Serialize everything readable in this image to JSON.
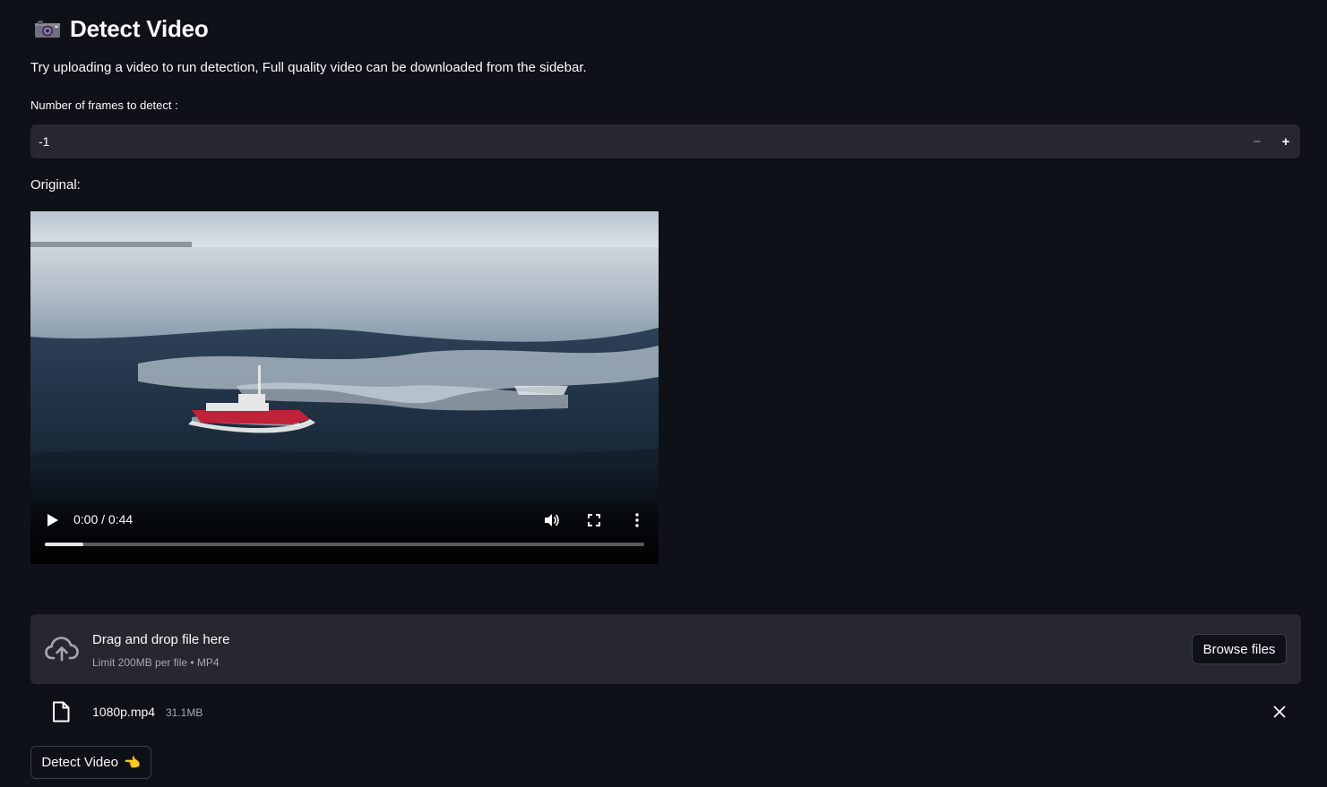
{
  "page": {
    "title": "Detect Video",
    "title_icon": "camera-icon",
    "intro": "Try uploading a video to run detection, Full quality video can be downloaded from the sidebar."
  },
  "frames_input": {
    "label": "Number of frames to detect :",
    "value": "-1",
    "decrement_label": "−",
    "increment_label": "+"
  },
  "original": {
    "label": "Original:",
    "time_display": "0:00 / 0:44",
    "progress_fraction": 0.064
  },
  "uploader": {
    "main_text": "Drag and drop file here",
    "sub_text": "Limit 200MB per file • MP4",
    "browse_label": "Browse files",
    "icon": "cloud-upload-icon"
  },
  "uploaded_file": {
    "name": "1080p.mp4",
    "size": "31.1MB",
    "icon": "file-icon"
  },
  "detect_button": {
    "label": "Detect Video",
    "emoji": "👈"
  },
  "colors": {
    "background": "#0e1117",
    "surface": "#262730",
    "text": "#fafafa",
    "muted": "#a3a8b8"
  }
}
